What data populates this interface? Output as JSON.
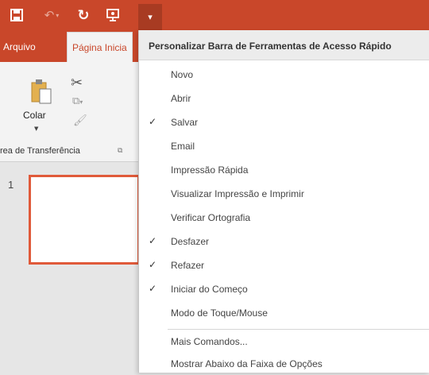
{
  "qat": {
    "save_icon": "save-icon",
    "undo_icon": "undo-icon",
    "redo_icon": "redo-icon",
    "start_icon": "start-from-beginning-icon",
    "dropdown_icon": "chevron-down-icon"
  },
  "tabs": {
    "file": "Arquivo",
    "home": "Página Inicia"
  },
  "ribbon": {
    "paste_label": "Colar",
    "clipboard_group": "rea de Transferência"
  },
  "slides": [
    {
      "number": "1"
    }
  ],
  "colors": {
    "accent": "#c9472a",
    "slide_border": "#e05a3a"
  },
  "menu": {
    "title": "Personalizar Barra de Ferramentas de Acesso Rápido",
    "items": [
      {
        "label": "Novo",
        "checked": false
      },
      {
        "label": "Abrir",
        "checked": false
      },
      {
        "label": "Salvar",
        "checked": true
      },
      {
        "label": "Email",
        "checked": false
      },
      {
        "label": "Impressão Rápida",
        "checked": false
      },
      {
        "label": "Visualizar Impressão e Imprimir",
        "checked": false
      },
      {
        "label": "Verificar Ortografia",
        "checked": false
      },
      {
        "label": "Desfazer",
        "checked": true
      },
      {
        "label": "Refazer",
        "checked": true
      },
      {
        "label": "Iniciar do Começo",
        "checked": true
      },
      {
        "label": "Modo de Toque/Mouse",
        "checked": false
      }
    ],
    "more_commands": "Mais Comandos...",
    "show_below": "Mostrar Abaixo da Faixa de Opções"
  }
}
